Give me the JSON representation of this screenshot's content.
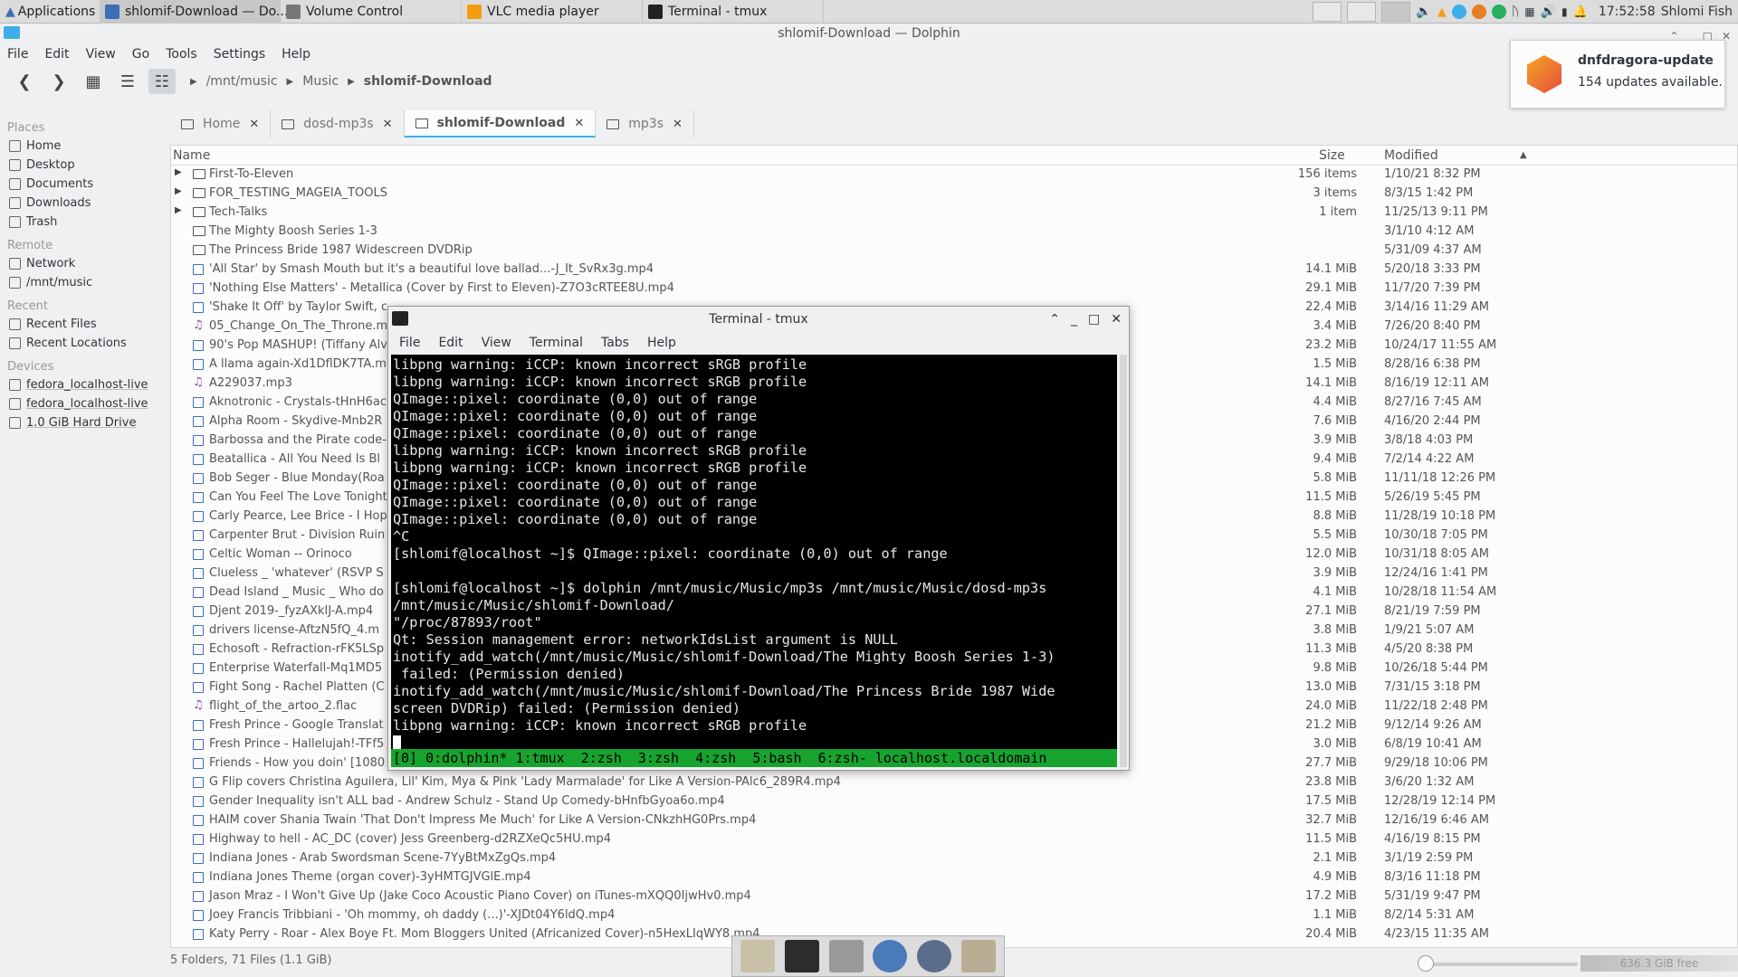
{
  "panel": {
    "apps_label": "Applications",
    "tasks": [
      {
        "label": "shlomif-Download — Do...",
        "color": "#3b6fb8",
        "active": true
      },
      {
        "label": "Volume Control",
        "color": "#777777",
        "active": false
      },
      {
        "label": "VLC media player",
        "color": "#f39c12",
        "active": false
      },
      {
        "label": "Terminal - tmux",
        "color": "#222222",
        "active": false
      }
    ],
    "clock": "17:52:58",
    "user": "Shlomi Fish"
  },
  "dolphin": {
    "title": "shlomif-Download — Dolphin",
    "menu": [
      "File",
      "Edit",
      "View",
      "Go",
      "Tools",
      "Settings",
      "Help"
    ],
    "breadcrumbs": [
      "/mnt/music",
      "Music",
      "shlomif-Download"
    ],
    "tabs": [
      {
        "label": "Home",
        "active": false
      },
      {
        "label": "dosd-mp3s",
        "active": false
      },
      {
        "label": "shlomif-Download",
        "active": true
      },
      {
        "label": "mp3s",
        "active": false
      }
    ],
    "columns": {
      "name": "Name",
      "size": "Size",
      "modified": "Modified"
    },
    "places": {
      "places_header": "Places",
      "places": [
        "Home",
        "Desktop",
        "Documents",
        "Downloads",
        "Trash"
      ],
      "remote_header": "Remote",
      "remote": [
        "Network",
        "/mnt/music"
      ],
      "recent_header": "Recent",
      "recent": [
        "Recent Files",
        "Recent Locations"
      ],
      "devices_header": "Devices",
      "devices": [
        "fedora_localhost-live",
        "fedora_localhost-live",
        "1.0 GiB Hard Drive"
      ]
    },
    "files": [
      {
        "name": "First-To-Eleven",
        "size": "156 items",
        "modified": "1/10/21 8:32 PM",
        "type": "folder",
        "expand": true
      },
      {
        "name": "FOR_TESTING_MAGEIA_TOOLS",
        "size": "3 items",
        "modified": "8/3/15 1:42 PM",
        "type": "folder",
        "expand": true
      },
      {
        "name": "Tech-Talks",
        "size": "1 item",
        "modified": "11/25/13 9:11 PM",
        "type": "folder",
        "expand": true
      },
      {
        "name": "The Mighty Boosh Series 1-3",
        "size": "",
        "modified": "3/1/10 4:12 AM",
        "type": "folder",
        "expand": false
      },
      {
        "name": "The Princess Bride 1987 Widescreen DVDRip",
        "size": "",
        "modified": "5/31/09 4:37 AM",
        "type": "folder",
        "expand": false
      },
      {
        "name": "'All Star' by Smash Mouth but it's a beautiful love ballad...-J_It_SvRx3g.mp4",
        "size": "14.1 MiB",
        "modified": "5/20/18 3:33 PM",
        "type": "video"
      },
      {
        "name": "'Nothing Else Matters' - Metallica (Cover by First to Eleven)-Z7O3cRTEE8U.mp4",
        "size": "29.1 MiB",
        "modified": "11/7/20 7:39 PM",
        "type": "video"
      },
      {
        "name": "'Shake It Off' by Taylor Swift, c",
        "size": "22.4 MiB",
        "modified": "3/14/16 11:29 AM",
        "type": "video"
      },
      {
        "name": "05_Change_On_The_Throne.m",
        "size": "3.4 MiB",
        "modified": "7/26/20 8:40 PM",
        "type": "music"
      },
      {
        "name": "90's Pop MASHUP! (Tiffany Alv",
        "size": "23.2 MiB",
        "modified": "10/24/17 11:55 AM",
        "type": "video"
      },
      {
        "name": "A llama again-Xd1DflDK7TA.m",
        "size": "1.5 MiB",
        "modified": "8/28/16 6:38 PM",
        "type": "video"
      },
      {
        "name": "A229037.mp3",
        "size": "14.1 MiB",
        "modified": "8/16/19 12:11 AM",
        "type": "music"
      },
      {
        "name": "Aknotronic - Crystals-tHnH6ac",
        "size": "4.4 MiB",
        "modified": "8/27/16 7:45 AM",
        "type": "video"
      },
      {
        "name": "Alpha Room - Skydive-Mnb2R",
        "size": "7.6 MiB",
        "modified": "4/16/20 2:44 PM",
        "type": "video"
      },
      {
        "name": "Barbossa and the Pirate code-",
        "size": "3.9 MiB",
        "modified": "3/8/18 4:03 PM",
        "type": "video"
      },
      {
        "name": "Beatallica - All You Need Is Bl",
        "size": "9.4 MiB",
        "modified": "7/2/14 4:22 AM",
        "type": "video"
      },
      {
        "name": "Bob Seger - Blue Monday(Roa",
        "size": "5.8 MiB",
        "modified": "11/11/18 12:26 PM",
        "type": "video"
      },
      {
        "name": "Can You Feel The Love Tonight",
        "size": "11.5 MiB",
        "modified": "5/26/19 5:45 PM",
        "type": "video"
      },
      {
        "name": "Carly Pearce, Lee Brice - I Hop",
        "size": "8.8 MiB",
        "modified": "11/28/19 10:18 PM",
        "type": "video"
      },
      {
        "name": "Carpenter Brut - Division Ruin",
        "size": "5.5 MiB",
        "modified": "10/30/18 7:05 PM",
        "type": "video"
      },
      {
        "name": "Celtic   Woman  --   Orinoco",
        "size": "12.0 MiB",
        "modified": "10/31/18 8:05 AM",
        "type": "video"
      },
      {
        "name": "Clueless _ 'whatever' (RSVP S",
        "size": "3.9 MiB",
        "modified": "12/24/16 1:41 PM",
        "type": "video"
      },
      {
        "name": "Dead Island _ Music _ Who do",
        "size": "4.1 MiB",
        "modified": "10/28/18 11:54 AM",
        "type": "video"
      },
      {
        "name": "Djent 2019-_fyzAXkIJ-A.mp4",
        "size": "27.1 MiB",
        "modified": "8/21/19 7:59 PM",
        "type": "video"
      },
      {
        "name": "drivers license-AftzN5fQ_4.m",
        "size": "3.8 MiB",
        "modified": "1/9/21 5:07 AM",
        "type": "video"
      },
      {
        "name": "Echosoft - Refraction-rFK5LSp",
        "size": "11.3 MiB",
        "modified": "4/5/20 8:38 PM",
        "type": "video"
      },
      {
        "name": "Enterprise Waterfall-Mq1MD5",
        "size": "9.8 MiB",
        "modified": "10/26/18 5:44 PM",
        "type": "video"
      },
      {
        "name": "Fight Song - Rachel Platten (C",
        "size": "13.0 MiB",
        "modified": "7/31/15 3:18 PM",
        "type": "video"
      },
      {
        "name": "flight_of_the_artoo_2.flac",
        "size": "24.0 MiB",
        "modified": "11/22/18 2:48 PM",
        "type": "music"
      },
      {
        "name": "Fresh Prince - Google Translat",
        "size": "21.2 MiB",
        "modified": "9/12/14 9:26 AM",
        "type": "video"
      },
      {
        "name": "Fresh Prince - Hallelujah!-TFf5",
        "size": "3.0 MiB",
        "modified": "6/8/19 10:41 AM",
        "type": "video"
      },
      {
        "name": "Friends - How you doin' [1080",
        "size": "27.7 MiB",
        "modified": "9/29/18 10:06 PM",
        "type": "video"
      },
      {
        "name": "G Flip covers Christina Aguilera, Lil' Kim, Mya & Pink 'Lady Marmalade' for Like A Version-PAlc6_289R4.mp4",
        "size": "23.8 MiB",
        "modified": "3/6/20 1:32 AM",
        "type": "video"
      },
      {
        "name": "Gender Inequality isn't ALL bad - Andrew Schulz - Stand Up Comedy-bHnfbGyoa6o.mp4",
        "size": "17.5 MiB",
        "modified": "12/28/19 12:14 PM",
        "type": "video"
      },
      {
        "name": "HAIM cover Shania Twain 'That Don't Impress Me Much' for Like A Version-CNkzhHG0Prs.mp4",
        "size": "32.7 MiB",
        "modified": "12/16/19 6:46 AM",
        "type": "video"
      },
      {
        "name": "Highway to hell - AC_DC (cover) Jess Greenberg-d2RZXeQc5HU.mp4",
        "size": "11.5 MiB",
        "modified": "4/16/19 8:15 PM",
        "type": "video"
      },
      {
        "name": "Indiana Jones - Arab Swordsman Scene-7YyBtMxZgQs.mp4",
        "size": "2.1 MiB",
        "modified": "3/1/19 2:59 PM",
        "type": "video"
      },
      {
        "name": "Indiana Jones Theme (organ cover)-3yHMTGJVGlE.mp4",
        "size": "4.9 MiB",
        "modified": "8/3/16 11:18 PM",
        "type": "video"
      },
      {
        "name": "Jason Mraz - I Won't Give Up (Jake Coco Acoustic Piano Cover) on iTunes-mXQQ0IjwHv0.mp4",
        "size": "17.2 MiB",
        "modified": "5/31/19 9:47 PM",
        "type": "video"
      },
      {
        "name": "Joey Francis Tribbiani - 'Oh mommy, oh daddy (...)'-XJDt04Y6ldQ.mp4",
        "size": "1.1 MiB",
        "modified": "8/2/14 5:31 AM",
        "type": "video"
      },
      {
        "name": "Katy Perry - Roar - Alex Boye Ft. Mom Bloggers United (Africanized Cover)-n5HexLIqWY8.mp4",
        "size": "20.4 MiB",
        "modified": "4/23/15 11:35 AM",
        "type": "video"
      }
    ],
    "status": "5 Folders, 71 Files (1.1 GiB)",
    "free_space": "636.3 GiB free"
  },
  "notification": {
    "title": "dnfdragora-update",
    "body": "154 updates available."
  },
  "terminal": {
    "title": "Terminal - tmux",
    "menu": [
      "File",
      "Edit",
      "View",
      "Terminal",
      "Tabs",
      "Help"
    ],
    "lines": [
      "libpng warning: iCCP: known incorrect sRGB profile",
      "libpng warning: iCCP: known incorrect sRGB profile",
      "QImage::pixel: coordinate (0,0) out of range",
      "QImage::pixel: coordinate (0,0) out of range",
      "QImage::pixel: coordinate (0,0) out of range",
      "libpng warning: iCCP: known incorrect sRGB profile",
      "libpng warning: iCCP: known incorrect sRGB profile",
      "QImage::pixel: coordinate (0,0) out of range",
      "QImage::pixel: coordinate (0,0) out of range",
      "QImage::pixel: coordinate (0,0) out of range",
      "^C",
      "[shlomif@localhost ~]$ QImage::pixel: coordinate (0,0) out of range",
      "",
      "[shlomif@localhost ~]$ dolphin /mnt/music/Music/mp3s /mnt/music/Music/dosd-mp3s",
      "/mnt/music/Music/shlomif-Download/",
      "\"/proc/87893/root\"",
      "Qt: Session management error: networkIdsList argument is NULL",
      "inotify_add_watch(/mnt/music/Music/shlomif-Download/The Mighty Boosh Series 1-3)",
      " failed: (Permission denied)",
      "inotify_add_watch(/mnt/music/Music/shlomif-Download/The Princess Bride 1987 Wide",
      "screen DVDRip) failed: (Permission denied)",
      "libpng warning: iCCP: known incorrect sRGB profile"
    ],
    "tmux_status": "[0] 0:dolphin* 1:tmux  2:zsh  3:zsh  4:zsh  5:bash  6:zsh- localhost.localdomain"
  },
  "colors": {
    "accent": "#3daee9",
    "tmux_green": "#18a32e"
  }
}
